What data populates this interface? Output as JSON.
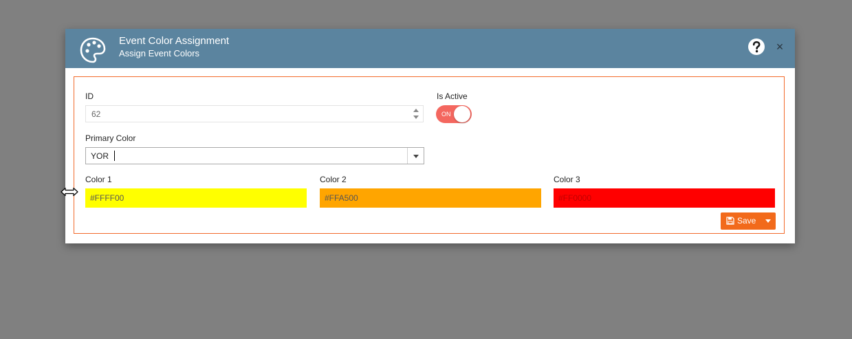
{
  "dialog": {
    "title": "Event Color Assignment",
    "subtitle": "Assign Event Colors",
    "header_icon": "palette-icon",
    "help_icon": "question-circle-icon",
    "close_label": "×"
  },
  "form": {
    "id_label": "ID",
    "id_value": "62",
    "is_active_label": "Is Active",
    "is_active_toggle": "ON",
    "is_active": true,
    "primary_color_label": "Primary Color",
    "primary_color_value": "YOR",
    "color1_label": "Color 1",
    "color1_value": "#FFFF00",
    "color2_label": "Color 2",
    "color2_value": "#FFA500",
    "color3_label": "Color 3",
    "color3_value": "#FF0000"
  },
  "actions": {
    "save_label": "Save",
    "save_icon": "floppy-disk-icon",
    "save_menu_icon": "caret-down-icon"
  },
  "colors": {
    "header_bg": "#5b849f",
    "accent": "#f26a1b",
    "toggle_on": "#f4675f",
    "overlay": "#808080"
  }
}
